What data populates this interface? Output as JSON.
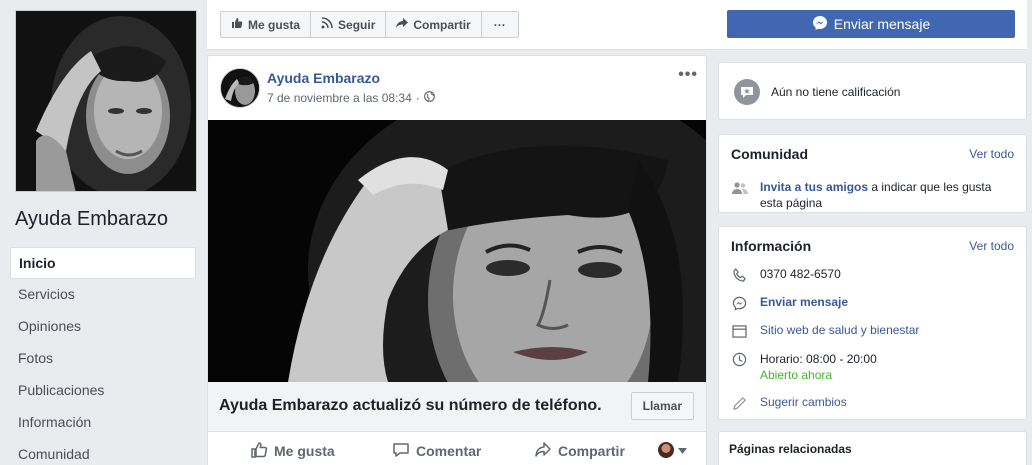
{
  "page": {
    "name": "Ayuda Embarazo"
  },
  "nav": {
    "items": [
      {
        "label": "Inicio",
        "active": true
      },
      {
        "label": "Servicios"
      },
      {
        "label": "Opiniones"
      },
      {
        "label": "Fotos"
      },
      {
        "label": "Publicaciones"
      },
      {
        "label": "Información"
      },
      {
        "label": "Comunidad"
      }
    ]
  },
  "topbar": {
    "like_label": "Me gusta",
    "follow_label": "Seguir",
    "share_label": "Compartir",
    "more_label": "···",
    "send_label": "Enviar mensaje"
  },
  "post": {
    "author": "Ayuda Embarazo",
    "timestamp": "7 de noviembre a las 08:34",
    "meta_sep": "·",
    "more_label": "•••",
    "update_text": "Ayuda Embarazo actualizó su número de teléfono.",
    "call_label": "Llamar",
    "actions": {
      "like": "Me gusta",
      "comment": "Comentar",
      "share": "Compartir"
    }
  },
  "sidebar": {
    "rating_text": "Aún no tiene calificación",
    "community": {
      "title": "Comunidad",
      "see_all": "Ver todo",
      "invite_link": "Invita a tus amigos",
      "invite_rest": " a indicar que les gusta",
      "invite_rest2": "esta página"
    },
    "info": {
      "title": "Información",
      "see_all": "Ver todo",
      "phone": "0370 482-6570",
      "send_message": "Enviar mensaje",
      "category": "Sitio web de salud y bienestar",
      "hours": "Horario: 08:00 - 20:00",
      "open_now": "Abierto ahora",
      "suggest": "Sugerir cambios"
    },
    "related": {
      "title": "Páginas relacionadas"
    }
  },
  "colors": {
    "brand_blue": "#4267b2",
    "link_blue": "#385898",
    "open_green": "#42b72a",
    "background": "#e9ebee"
  }
}
